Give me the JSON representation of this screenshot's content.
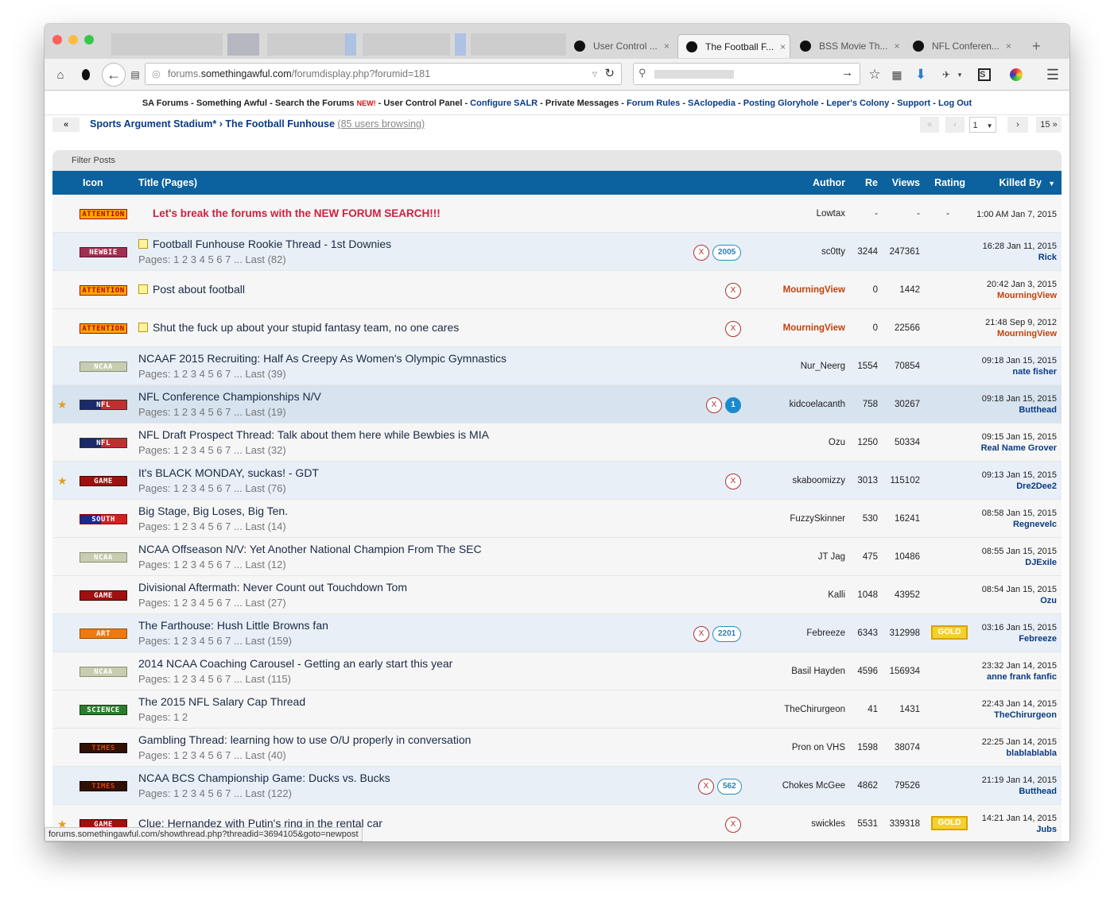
{
  "tabs": [
    {
      "label": "User Control ...",
      "close": "×",
      "active": false
    },
    {
      "label": "The Football F...",
      "close": "×",
      "active": true
    },
    {
      "label": "BSS Movie Th...",
      "close": "×",
      "active": false
    },
    {
      "label": "NFL Conferen...",
      "close": "×",
      "active": false
    }
  ],
  "new_tab": "+",
  "url": {
    "prefix": "forums.",
    "domain": "somethingawful.com",
    "path": "/forumdisplay.php?forumid=181"
  },
  "topnav": [
    "SA Forums",
    "Something Awful",
    "Search the Forums",
    "NEW!",
    "User Control Panel",
    "Configure SALR",
    "Private Messages",
    "Forum Rules",
    "SAclopedia",
    "Posting Gloryhole",
    "Leper's Colony",
    "Support",
    "Log Out"
  ],
  "breadcrumb": {
    "back": "«",
    "forum": "Sports Argument Stadium*",
    "sep": "›",
    "sub": "The Football Funhouse",
    "browsing": "(85 users browsing)"
  },
  "pagination": {
    "first": "«",
    "prev": "‹",
    "current": "1",
    "next": "›",
    "last": "15 »"
  },
  "filter_label": "Filter Posts",
  "columns": {
    "icon": "Icon",
    "title": "Title (Pages)",
    "author": "Author",
    "re": "Re",
    "views": "Views",
    "rating": "Rating",
    "killed": "Killed By"
  },
  "threads": [
    {
      "tag": "ATTENTION",
      "title": "Let's break the forums with the NEW FORUM SEARCH!!!",
      "pages": "",
      "author": "Lowtax",
      "re": "-",
      "views": "-",
      "rating": "-",
      "killed_time": "1:00 AM Jan 7, 2015",
      "killed_by": ""
    },
    {
      "tag": "NEWBIE",
      "title": "Football Funhouse Rookie Thread - 1st Downies",
      "pages": "Pages: 1 2 3 4 5 6 7 ... Last (82)",
      "unread": "2005",
      "author": "sc0tty",
      "re": "3244",
      "views": "247361",
      "rating": "",
      "killed_time": "16:28 Jan 11, 2015",
      "killed_by": "Rick"
    },
    {
      "tag": "ATTENTION",
      "title": "Post about football",
      "pages": "",
      "author": "MourningView",
      "re": "0",
      "views": "1442",
      "rating": "",
      "killed_time": "20:42 Jan 3, 2015",
      "killed_by": "MourningView"
    },
    {
      "tag": "ATTENTION",
      "title": "Shut the fuck up about your stupid fantasy team, no one cares",
      "pages": "",
      "author": "MourningView",
      "re": "0",
      "views": "22566",
      "rating": "",
      "killed_time": "21:48 Sep 9, 2012",
      "killed_by": "MourningView"
    },
    {
      "tag": "NCAA",
      "title": "NCAAF 2015 Recruiting: Half As Creepy As Women's Olympic Gymnastics",
      "pages": "Pages: 1 2 3 4 5 6 7 ... Last (39)",
      "author": "Nur_Neerg",
      "re": "1554",
      "views": "70854",
      "rating": "",
      "killed_time": "09:18 Jan 15, 2015",
      "killed_by": "nate fisher"
    },
    {
      "tag": "NFL",
      "title": "NFL Conference Championships N/V",
      "pages": "Pages: 1 2 3 4 5 6 7 ... Last (19)",
      "unread": "1",
      "author": "kidcoelacanth",
      "re": "758",
      "views": "30267",
      "rating": "",
      "killed_time": "09:18 Jan 15, 2015",
      "killed_by": "Butthead"
    },
    {
      "tag": "NFL",
      "title": "NFL Draft Prospect Thread: Talk about them here while Bewbies is MIA",
      "pages": "Pages: 1 2 3 4 5 6 7 ... Last (32)",
      "author": "Ozu",
      "re": "1250",
      "views": "50334",
      "rating": "",
      "killed_time": "09:15 Jan 15, 2015",
      "killed_by": "Real Name Grover"
    },
    {
      "tag": "GAME",
      "title": "It's BLACK MONDAY, suckas! - GDT",
      "pages": "Pages: 1 2 3 4 5 6 7 ... Last (76)",
      "author": "skaboomizzy",
      "re": "3013",
      "views": "115102",
      "rating": "",
      "killed_time": "09:13 Jan 15, 2015",
      "killed_by": "Dre2Dee2"
    },
    {
      "tag": "SOUTH",
      "title": "Big Stage, Big Loses, Big Ten.",
      "pages": "Pages: 1 2 3 4 5 6 7 ... Last (14)",
      "author": "FuzzySkinner",
      "re": "530",
      "views": "16241",
      "rating": "",
      "killed_time": "08:58 Jan 15, 2015",
      "killed_by": "Regnevelc"
    },
    {
      "tag": "NCAA",
      "title": "NCAA Offseason N/V: Yet Another National Champion From The SEC",
      "pages": "Pages: 1 2 3 4 5 6 7 ... Last (12)",
      "author": "JT Jag",
      "re": "475",
      "views": "10486",
      "rating": "",
      "killed_time": "08:55 Jan 15, 2015",
      "killed_by": "DJExile"
    },
    {
      "tag": "GAME",
      "title": "Divisional Aftermath: Never Count out Touchdown Tom",
      "pages": "Pages: 1 2 3 4 5 6 7 ... Last (27)",
      "author": "Kalli",
      "re": "1048",
      "views": "43952",
      "rating": "",
      "killed_time": "08:54 Jan 15, 2015",
      "killed_by": "Ozu"
    },
    {
      "tag": "ART",
      "title": "The Farthouse: Hush Little Browns fan",
      "pages": "Pages: 1 2 3 4 5 6 7 ... Last (159)",
      "unread": "2201",
      "author": "Febreeze",
      "re": "6343",
      "views": "312998",
      "rating": "GOLD",
      "killed_time": "03:16 Jan 15, 2015",
      "killed_by": "Febreeze"
    },
    {
      "tag": "NCAA",
      "title": "2014 NCAA Coaching Carousel - Getting an early start this year",
      "pages": "Pages: 1 2 3 4 5 6 7 ... Last (115)",
      "author": "Basil Hayden",
      "re": "4596",
      "views": "156934",
      "rating": "",
      "killed_time": "23:32 Jan 14, 2015",
      "killed_by": "anne frank fanfic"
    },
    {
      "tag": "SCIENCE",
      "title": "The 2015 NFL Salary Cap Thread",
      "pages": "Pages: 1 2",
      "author": "TheChirurgeon",
      "re": "41",
      "views": "1431",
      "rating": "",
      "killed_time": "22:43 Jan 14, 2015",
      "killed_by": "TheChirurgeon"
    },
    {
      "tag": "TIMES",
      "title": "Gambling Thread: learning how to use O/U properly in conversation",
      "pages": "Pages: 1 2 3 4 5 6 7 ... Last (40)",
      "author": "Pron on VHS",
      "re": "1598",
      "views": "38074",
      "rating": "",
      "killed_time": "22:25 Jan 14, 2015",
      "killed_by": "blablablabla"
    },
    {
      "tag": "TIMES",
      "title": "NCAA BCS Championship Game: Ducks vs. Bucks",
      "pages": "Pages: 1 2 3 4 5 6 7 ... Last (122)",
      "unread": "562",
      "author": "Chokes McGee",
      "re": "4862",
      "views": "79526",
      "rating": "",
      "killed_time": "21:19 Jan 14, 2015",
      "killed_by": "Butthead"
    },
    {
      "tag": "GAME",
      "title": "Clue: Hernandez with Putin's ring in the rental car",
      "pages": "",
      "author": "swickles",
      "re": "5531",
      "views": "339318",
      "rating": "GOLD",
      "killed_time": "14:21 Jan 14, 2015",
      "killed_by": "Jubs"
    }
  ],
  "status_url": "forums.somethingawful.com/showthread.php?threadid=3694105&goto=newpost"
}
